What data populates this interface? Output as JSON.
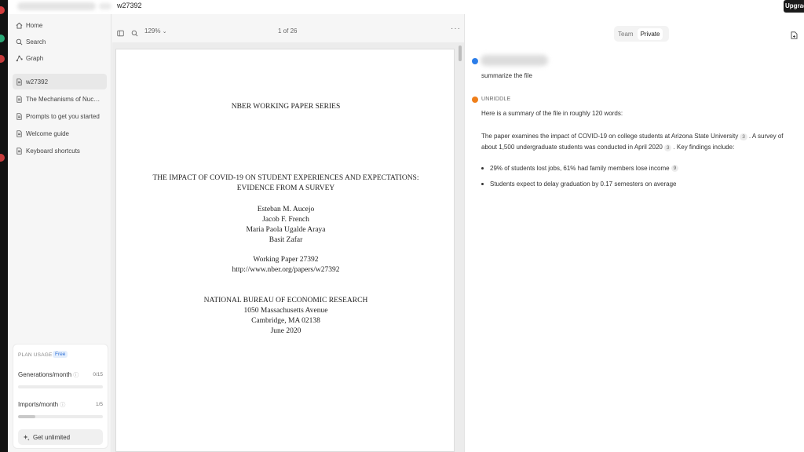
{
  "topbar": {
    "document_tab": "w27392",
    "upgrade_label": "Upgrac"
  },
  "sidebar": {
    "items": [
      {
        "label": "Home",
        "icon": "home-icon"
      },
      {
        "label": "Search",
        "icon": "search-icon"
      },
      {
        "label": "Graph",
        "icon": "graph-icon"
      },
      {
        "label": "w27392",
        "icon": "document-icon",
        "active": true
      },
      {
        "label": "The Mechanisms of Nucle...",
        "icon": "document-icon"
      },
      {
        "label": "Prompts to get you started",
        "icon": "document-icon"
      },
      {
        "label": "Welcome guide",
        "icon": "document-icon"
      },
      {
        "label": "Keyboard shortcuts",
        "icon": "document-icon"
      }
    ],
    "usage": {
      "title": "PLAN USAGE",
      "badge": "Free",
      "generations_label": "Generations/month",
      "generations_count": "0/15",
      "generations_fraction": 0.0,
      "imports_label": "Imports/month",
      "imports_count": "1/5",
      "imports_fraction": 0.2,
      "cta_label": "Get unlimited"
    }
  },
  "viewer": {
    "zoom": "129%",
    "page_indicator": "1 of 26",
    "more": "···",
    "pdf_lines": [
      "NBER WORKING PAPER SERIES",
      "THE IMPACT OF COVID-19 ON STUDENT EXPERIENCES AND EXPECTATIONS:",
      "EVIDENCE FROM A SURVEY",
      "Esteban M. Aucejo",
      "Jacob F. French",
      "Maria Paola Ugalde Araya",
      "Basit Zafar",
      "Working Paper 27392",
      "http://www.nber.org/papers/w27392",
      "NATIONAL BUREAU OF ECONOMIC RESEARCH",
      "1050 Massachusetts Avenue",
      "Cambridge, MA 02138",
      "June 2020"
    ]
  },
  "chat": {
    "segment": {
      "team": "Team",
      "private": "Private"
    },
    "user_message": "summarize the file",
    "bot_name": "UNRIDDLE",
    "bot_intro": "Here is a summary of the file in roughly 120 words:",
    "para": {
      "part1": "The paper examines the impact of COVID-19 on college students at Arizona State University",
      "cite1": "3",
      "part2": ". A survey of about 1,500 undergraduate students was conducted in April 2020",
      "cite2": "3",
      "part3": ". Key findings include:"
    },
    "bullets": [
      {
        "text": "29% of students lost jobs, 61% had family members lose income",
        "cite": "9"
      },
      {
        "text": "Students expect to delay graduation by 0.17 semesters on average",
        "cite": ""
      }
    ],
    "colors": {
      "user_dot": "#2b7de9",
      "bot_dot": "#ef7f1a"
    }
  }
}
